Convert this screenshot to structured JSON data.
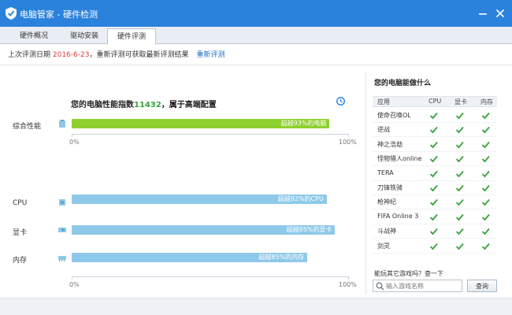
{
  "window": {
    "title": "电脑管家 - 硬件检测"
  },
  "tabs": [
    {
      "label": "硬件概况",
      "active": false
    },
    {
      "label": "驱动安装",
      "active": false
    },
    {
      "label": "硬件评测",
      "active": true
    }
  ],
  "info": {
    "prefix": "上次评测日期 ",
    "date": "2016-6-23",
    "suffix": "，重新评测可获取最新评测结果",
    "rerun_link": "重新评测"
  },
  "summary": {
    "headline_prefix": "您的电脑性能指数",
    "score": "11432",
    "headline_suffix": "，属于高端配置"
  },
  "overall": {
    "label": "综合性能",
    "percent": 93,
    "bar_text": "超越93%的电脑"
  },
  "components": [
    {
      "label": "CPU",
      "percent": 92,
      "bar_text": "超越92%的CPU"
    },
    {
      "label": "显卡",
      "percent": 95,
      "bar_text": "超越95%的显卡"
    },
    {
      "label": "内存",
      "percent": 85,
      "bar_text": "超越85%的内存"
    }
  ],
  "axis": {
    "min_label": "0%",
    "max_label": "100%"
  },
  "games_panel": {
    "title": "您的电脑能做什么",
    "columns": [
      "应用",
      "CPU",
      "显卡",
      "内存"
    ],
    "rows": [
      {
        "app": "使命召唤OL",
        "cpu": true,
        "gpu": true,
        "mem": true
      },
      {
        "app": "逆战",
        "cpu": true,
        "gpu": true,
        "mem": true
      },
      {
        "app": "神之浩劫",
        "cpu": true,
        "gpu": true,
        "mem": true
      },
      {
        "app": "怪物猎人online",
        "cpu": true,
        "gpu": true,
        "mem": true
      },
      {
        "app": "TERA",
        "cpu": true,
        "gpu": true,
        "mem": true
      },
      {
        "app": "刀锋铁骑",
        "cpu": true,
        "gpu": true,
        "mem": true
      },
      {
        "app": "枪神纪",
        "cpu": true,
        "gpu": true,
        "mem": true
      },
      {
        "app": "FIFA Online 3",
        "cpu": true,
        "gpu": true,
        "mem": true
      },
      {
        "app": "斗战神",
        "cpu": true,
        "gpu": true,
        "mem": true
      },
      {
        "app": "剑灵",
        "cpu": true,
        "gpu": true,
        "mem": true
      }
    ],
    "search_prompt": "能玩其它游戏吗？查一下",
    "search_placeholder": "输入游戏名称",
    "search_button": "查询"
  },
  "colors": {
    "accent": "#2a82dd",
    "green_bar": "#8ed12f",
    "blue_bar": "#8ec9ea",
    "check": "#3aa33a",
    "date": "#e33b3b"
  }
}
